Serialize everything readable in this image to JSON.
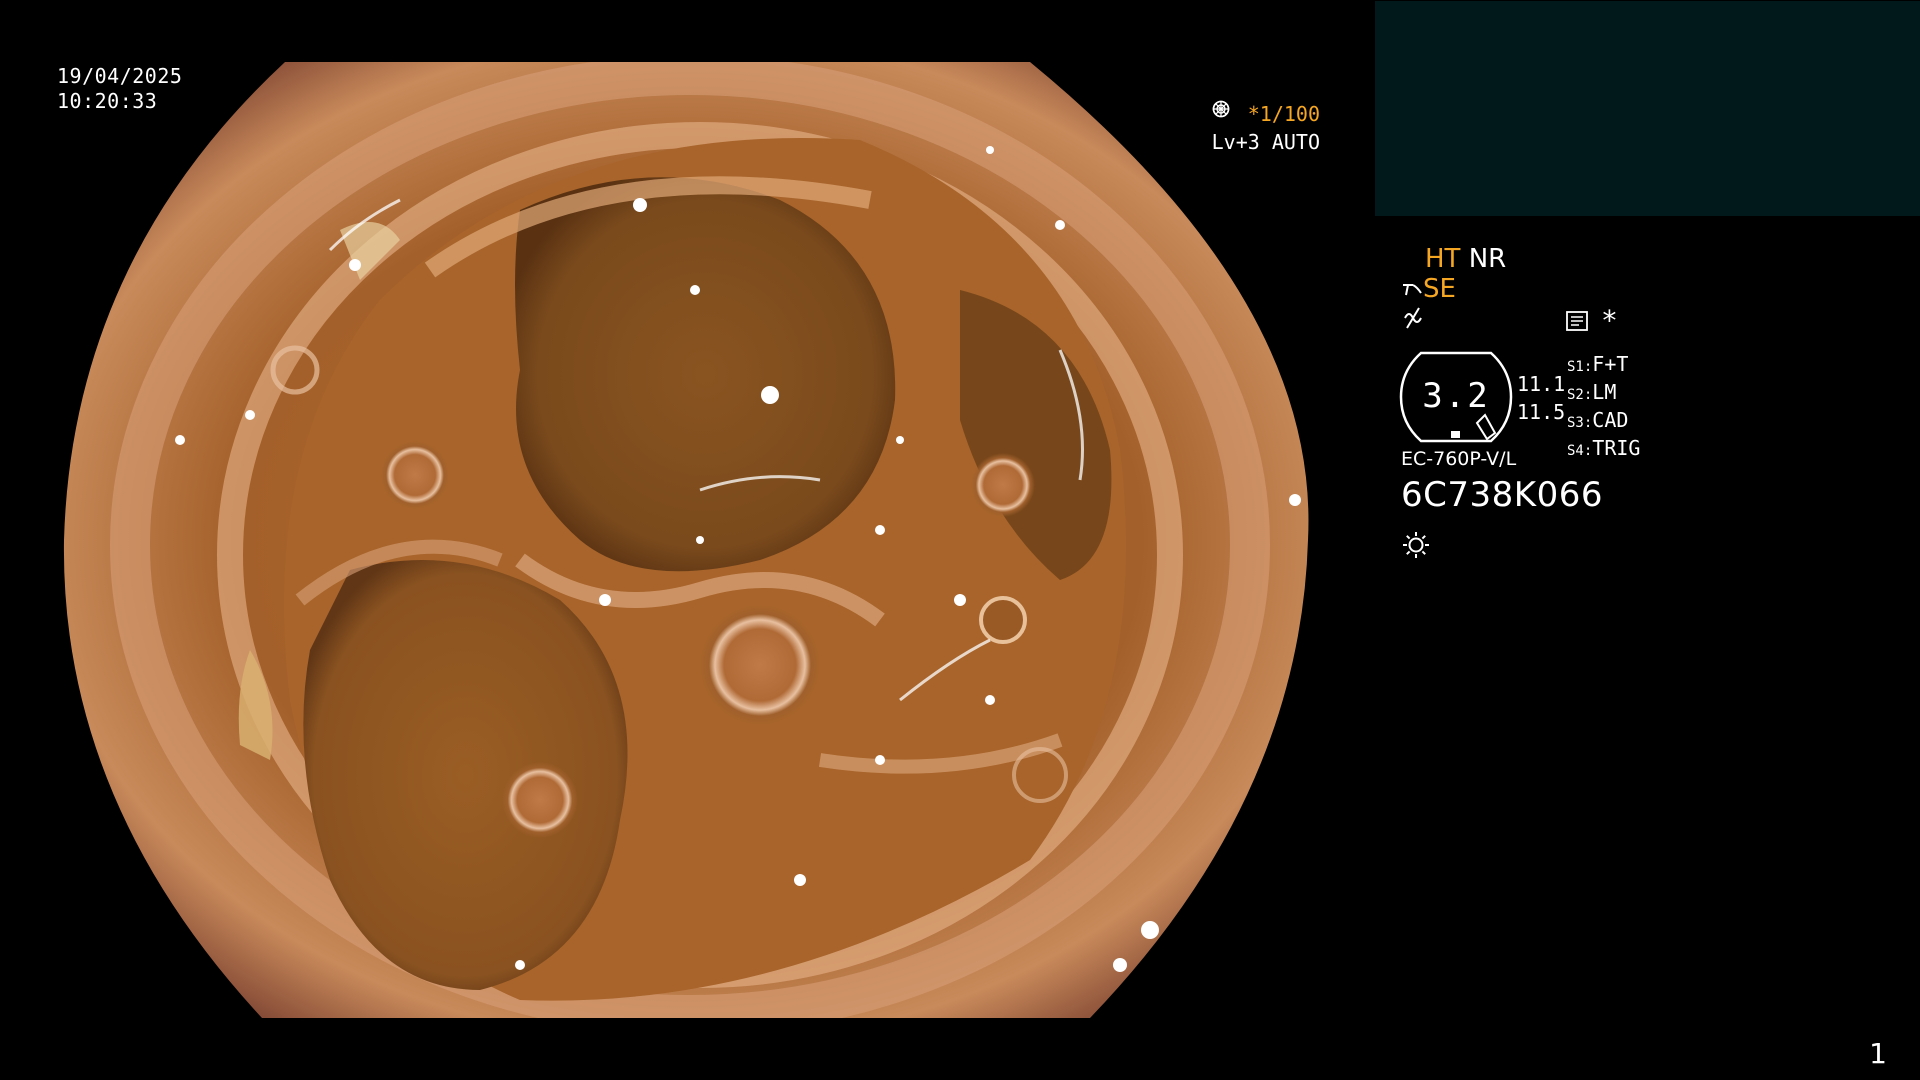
{
  "overlay": {
    "date": "19/04/2025",
    "time": "10:20:33",
    "shutter_speed": "*1/100",
    "iris_mode": "Lv+3 AUTO"
  },
  "panel": {
    "mode_ht": "HT",
    "mode_nr": "NR",
    "mode_se": "SE",
    "asterisk": "*",
    "zoom_value": "3.2",
    "cal_values": [
      "11.1",
      "11.5"
    ],
    "switches": [
      {
        "key": "S1:",
        "value": "F+T"
      },
      {
        "key": "S2:",
        "value": "LM"
      },
      {
        "key": "S3:",
        "value": "CAD"
      },
      {
        "key": "S4:",
        "value": "TRIG"
      }
    ],
    "scope_model": "EC-760P-V/L",
    "serial_number": "6C738K066"
  },
  "page_number": "1",
  "icons": [
    "shutter-icon",
    "auto-iris-icon",
    "probe-icon",
    "structure-icon",
    "memo-icon",
    "light-icon"
  ],
  "colors": {
    "accent_orange": "#f5a623",
    "thumb_box": "#01191b"
  }
}
